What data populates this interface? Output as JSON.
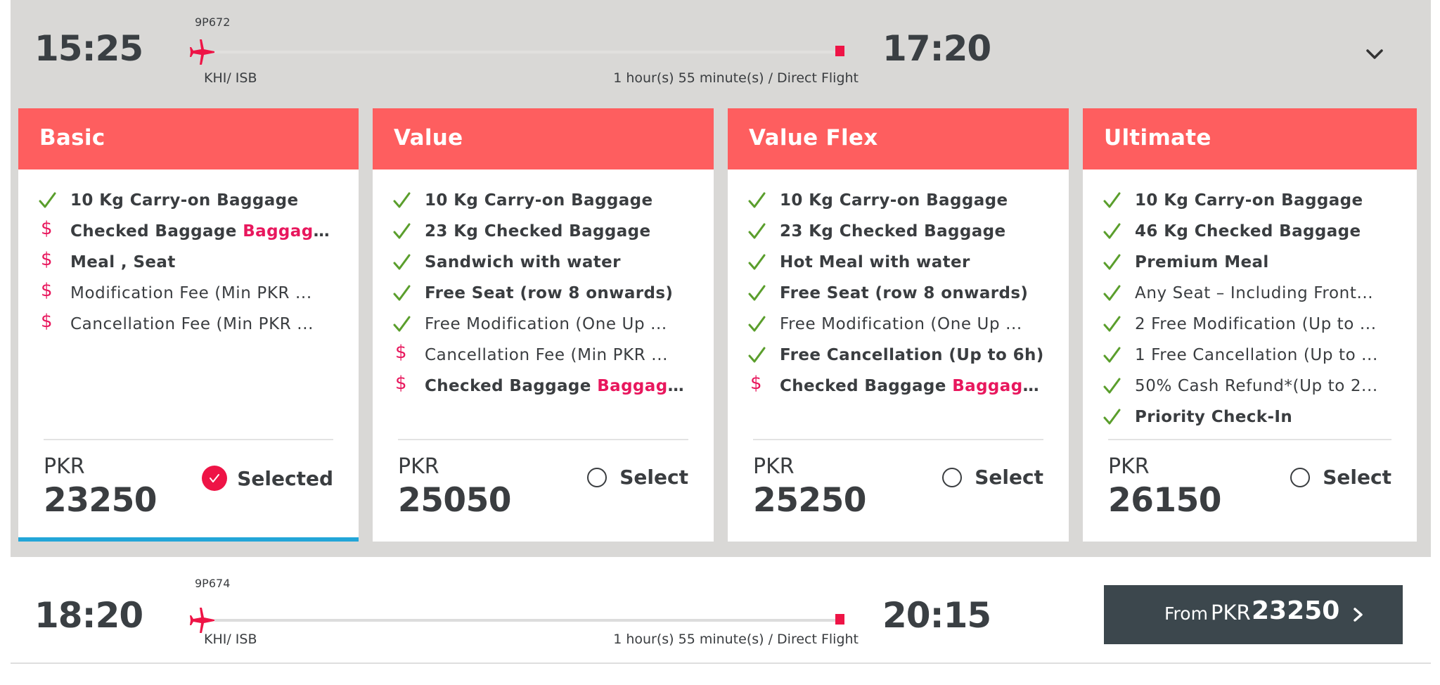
{
  "flights": [
    {
      "flight_number": "9P672",
      "departure_time": "15:25",
      "arrival_time": "17:20",
      "route": "KHI/ ISB",
      "duration": "1 hour(s) 55 minute(s) / Direct Flight",
      "expanded": true,
      "collapse_icon": "chevron-down-icon"
    },
    {
      "flight_number": "9P674",
      "departure_time": "18:20",
      "arrival_time": "20:15",
      "route": "KHI/ ISB",
      "duration": "1 hour(s) 55 minute(s) / Direct Flight",
      "expanded": false,
      "from_label": "From",
      "from_currency": "PKR",
      "from_price": "23250"
    }
  ],
  "fares": [
    {
      "name": "Basic",
      "currency": "PKR",
      "price": "23250",
      "selected": true,
      "select_label": "Selected",
      "features": [
        {
          "icon": "check",
          "text": "10 Kg Carry-on Baggage",
          "bold": true
        },
        {
          "icon": "dollar",
          "text": "Checked Baggage ",
          "highlight": "Baggage...",
          "bold": true
        },
        {
          "icon": "dollar",
          "text": "Meal , Seat",
          "bold": true
        },
        {
          "icon": "dollar",
          "text": "Modification Fee (Min PKR ...",
          "bold": false
        },
        {
          "icon": "dollar",
          "text": "Cancellation Fee (Min PKR ...",
          "bold": false
        }
      ]
    },
    {
      "name": "Value",
      "currency": "PKR",
      "price": "25050",
      "selected": false,
      "select_label": "Select",
      "features": [
        {
          "icon": "check",
          "text": "10 Kg Carry-on Baggage",
          "bold": true
        },
        {
          "icon": "check",
          "text": "23 Kg Checked Baggage",
          "bold": true
        },
        {
          "icon": "check",
          "text": "Sandwich with water",
          "bold": true
        },
        {
          "icon": "check",
          "text": "Free Seat (row 8 onwards)",
          "bold": true
        },
        {
          "icon": "check",
          "text": "Free Modification (One Up ...",
          "bold": false
        },
        {
          "icon": "dollar",
          "text": "Cancellation Fee (Min PKR ...",
          "bold": false
        },
        {
          "icon": "dollar",
          "text": "Checked Baggage ",
          "highlight": "Baggage...",
          "bold": true
        }
      ]
    },
    {
      "name": "Value Flex",
      "currency": "PKR",
      "price": "25250",
      "selected": false,
      "select_label": "Select",
      "features": [
        {
          "icon": "check",
          "text": "10 Kg Carry-on Baggage",
          "bold": true
        },
        {
          "icon": "check",
          "text": "23 Kg Checked Baggage",
          "bold": true
        },
        {
          "icon": "check",
          "text": "Hot Meal with water",
          "bold": true
        },
        {
          "icon": "check",
          "text": "Free Seat (row 8 onwards)",
          "bold": true
        },
        {
          "icon": "check",
          "text": "Free Modification (One Up ...",
          "bold": false
        },
        {
          "icon": "check",
          "text": "Free Cancellation (Up to 6h)",
          "bold": true
        },
        {
          "icon": "dollar",
          "text": "Checked Baggage ",
          "highlight": "Baggage...",
          "bold": true
        }
      ]
    },
    {
      "name": "Ultimate",
      "currency": "PKR",
      "price": "26150",
      "selected": false,
      "select_label": "Select",
      "features": [
        {
          "icon": "check",
          "text": "10 Kg Carry-on Baggage",
          "bold": true
        },
        {
          "icon": "check",
          "text": "46 Kg Checked Baggage",
          "bold": true
        },
        {
          "icon": "check",
          "text": "Premium Meal",
          "bold": true
        },
        {
          "icon": "check",
          "text": "Any Seat – Including Front...",
          "bold": false
        },
        {
          "icon": "check",
          "text": "2 Free Modification (Up to ...",
          "bold": false
        },
        {
          "icon": "check",
          "text": "1 Free Cancellation (Up to ...",
          "bold": false
        },
        {
          "icon": "check",
          "text": "50% Cash Refund*(Up to 2...",
          "bold": false
        },
        {
          "icon": "check",
          "text": "Priority Check-In",
          "bold": true
        }
      ]
    }
  ],
  "colors": {
    "header_bg": "#fe5e5f",
    "accent_red": "#ee1446",
    "highlight_pink": "#e8175d",
    "check_green": "#5a9e2c",
    "selected_bar": "#22a6d8",
    "panel_bg": "#d9d8d6",
    "button_dark": "#3c474d"
  }
}
